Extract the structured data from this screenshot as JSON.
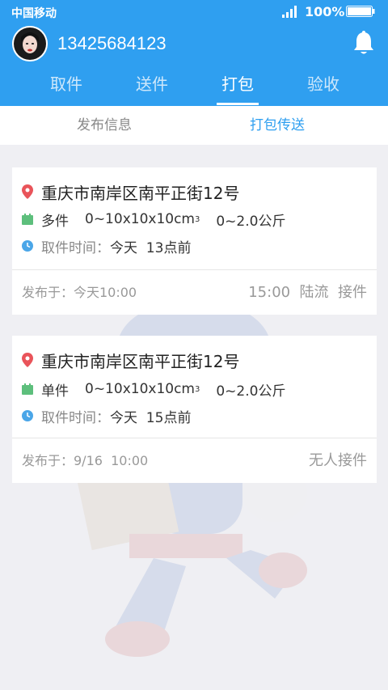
{
  "status_bar": {
    "carrier": "中国移动",
    "battery": "100%"
  },
  "user": {
    "phone": "13425684123"
  },
  "tabs": [
    {
      "label": "取件",
      "active": false
    },
    {
      "label": "送件",
      "active": false
    },
    {
      "label": "打包",
      "active": true
    },
    {
      "label": "验收",
      "active": false
    }
  ],
  "subtabs": [
    {
      "label": "发布信息",
      "active": false
    },
    {
      "label": "打包传送",
      "active": true
    }
  ],
  "orders": [
    {
      "address": "重庆市南岸区南平正街12号",
      "quantity": "多件",
      "size": "0~10x10x10cm",
      "size_sup": "3",
      "weight": "0~2.0公斤",
      "pickup_label": "取件时间：",
      "pickup_time": "今天  13点前",
      "published": "发布于：今天10:00",
      "status": "15:00  陆流  接件"
    },
    {
      "address": "重庆市南岸区南平正街12号",
      "quantity": "单件",
      "size": "0~10x10x10cm",
      "size_sup": "3",
      "weight": "0~2.0公斤",
      "pickup_label": "取件时间：",
      "pickup_time": "今天  15点前",
      "published": "发布于：9/16  10:00",
      "status": "无人接件"
    }
  ],
  "icons": {
    "location": "location-pin-icon",
    "package": "package-icon",
    "clock": "clock-icon",
    "bell": "bell-icon",
    "signal": "signal-icon",
    "battery": "battery-icon"
  },
  "colors": {
    "brand": "#2f9ff0",
    "location": "#e9545a",
    "package": "#5dbf7c",
    "clock": "#4aa6e8"
  }
}
